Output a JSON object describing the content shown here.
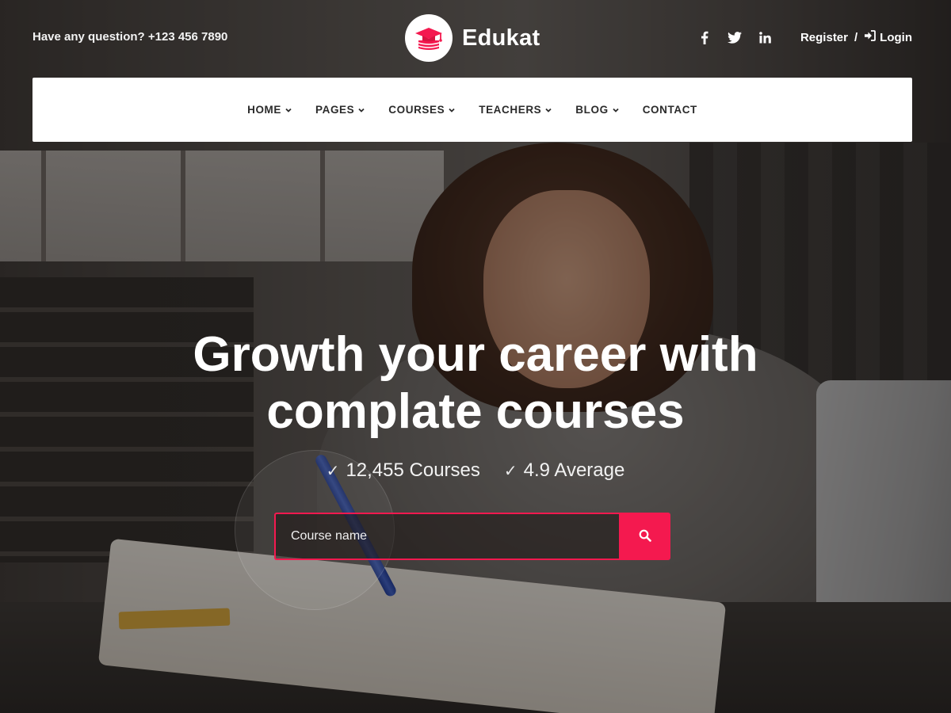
{
  "topbar": {
    "contact": "Have any question? +123 456 7890",
    "brand_name": "Edukat",
    "socials": [
      {
        "icon": "facebook-icon"
      },
      {
        "icon": "twitter-icon"
      },
      {
        "icon": "linkedin-icon"
      }
    ],
    "register_label": "Register",
    "separator": "/",
    "login_label": "Login"
  },
  "nav": {
    "items": [
      {
        "label": "HOME",
        "has_dropdown": true
      },
      {
        "label": "PAGES",
        "has_dropdown": true
      },
      {
        "label": "COURSES",
        "has_dropdown": true
      },
      {
        "label": "TEACHERS",
        "has_dropdown": true
      },
      {
        "label": "BLOG",
        "has_dropdown": true
      },
      {
        "label": "CONTACT",
        "has_dropdown": false
      }
    ]
  },
  "hero": {
    "headline_line1": "Growth your career with",
    "headline_line2": "complate courses",
    "stats": [
      {
        "icon": "check-icon",
        "text": "12,455 Courses"
      },
      {
        "icon": "check-icon",
        "text": "4.9 Average"
      }
    ],
    "search": {
      "placeholder": "Course name",
      "value": "",
      "button_icon": "search-icon"
    }
  },
  "colors": {
    "accent": "#f4194f",
    "nav_text": "#2b2b2b",
    "white": "#ffffff"
  }
}
